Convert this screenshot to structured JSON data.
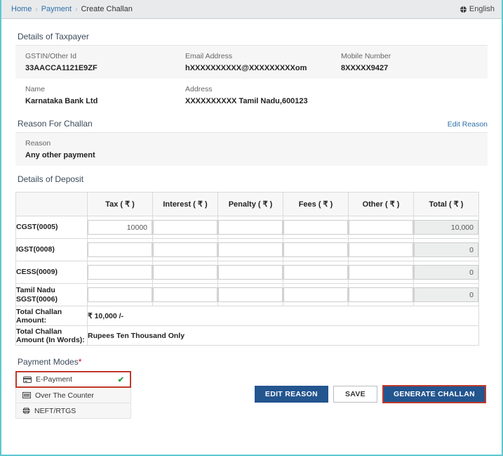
{
  "breadcrumb": {
    "items": [
      "Home",
      "Payment",
      "Create Challan"
    ],
    "separator": "›"
  },
  "language": {
    "label": "English",
    "icon": "globe-icon"
  },
  "taxpayer": {
    "section_title": "Details of Taxpayer",
    "fields": [
      {
        "label": "GSTIN/Other Id",
        "value": "33AACCA1121E9ZF"
      },
      {
        "label": "Email Address",
        "value": "hXXXXXXXXXX@XXXXXXXXXom"
      },
      {
        "label": "Mobile Number",
        "value": "8XXXXX9427"
      },
      {
        "label": "Name",
        "value": "Karnataka Bank Ltd"
      },
      {
        "label": "Address",
        "value": "XXXXXXXXXX Tamil Nadu,600123"
      }
    ]
  },
  "reason": {
    "section_title": "Reason For Challan",
    "edit_link": "Edit Reason",
    "field_label": "Reason",
    "field_value": "Any other payment"
  },
  "deposit": {
    "section_title": "Details of Deposit",
    "columns": [
      "",
      "Tax ( ₹ )",
      "Interest ( ₹ )",
      "Penalty ( ₹ )",
      "Fees ( ₹ )",
      "Other ( ₹ )",
      "Total ( ₹ )"
    ],
    "rows": [
      {
        "label": "CGST(0005)",
        "tax": "10000",
        "interest": "",
        "penalty": "",
        "fees": "",
        "other": "",
        "total": "10,000"
      },
      {
        "label": "IGST(0008)",
        "tax": "",
        "interest": "",
        "penalty": "",
        "fees": "",
        "other": "",
        "total": "0"
      },
      {
        "label": "CESS(0009)",
        "tax": "",
        "interest": "",
        "penalty": "",
        "fees": "",
        "other": "",
        "total": "0"
      },
      {
        "label": "Tamil Nadu SGST(0006)",
        "tax": "",
        "interest": "",
        "penalty": "",
        "fees": "",
        "other": "",
        "total": "0"
      }
    ],
    "total_amount_label": "Total Challan Amount:",
    "total_amount_value": "₹ 10,000 /-",
    "total_words_label": "Total Challan Amount (In Words):",
    "total_words_value": "Rupees Ten Thousand Only"
  },
  "payment_modes": {
    "title": "Payment Modes",
    "required_marker": "*",
    "items": [
      {
        "label": "E-Payment",
        "icon": "credit-card-icon",
        "selected": true,
        "check": "✔"
      },
      {
        "label": "Over The Counter",
        "icon": "counter-icon",
        "selected": false,
        "check": ""
      },
      {
        "label": "NEFT/RTGS",
        "icon": "globe-icon",
        "selected": false,
        "check": ""
      }
    ]
  },
  "footer": {
    "edit_reason_label": "EDIT REASON",
    "save_label": "SAVE",
    "generate_label": "GENERATE CHALLAN"
  },
  "colors": {
    "frame_border": "#5ec8d0",
    "primary_button": "#23558f",
    "highlight_border": "#c0392b",
    "link": "#2f6fa8",
    "check_green": "#2e9b3e",
    "required_red": "#d0021b"
  }
}
